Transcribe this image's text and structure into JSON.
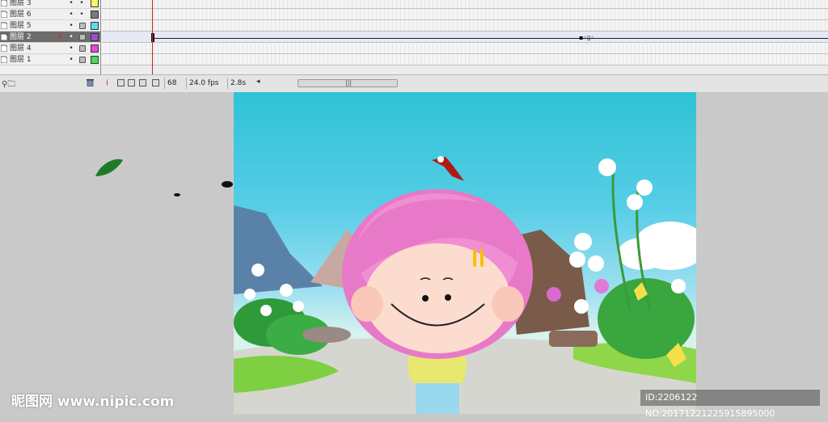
{
  "layers": [
    {
      "name": "图层 3",
      "swatch": "#f5f56a",
      "locked": false,
      "selected": false
    },
    {
      "name": "图层 6",
      "swatch": "#7a7a7a",
      "locked": false,
      "selected": false
    },
    {
      "name": "图层 5",
      "swatch": "#5ed8f0",
      "locked": true,
      "selected": false
    },
    {
      "name": "图层 2",
      "swatch": "#9a4dd8",
      "locked": true,
      "selected": true
    },
    {
      "name": "图层 4",
      "swatch": "#ee44d8",
      "locked": true,
      "selected": false
    },
    {
      "name": "图层 1",
      "swatch": "#44dd55",
      "locked": true,
      "selected": false
    }
  ],
  "timeline_status": {
    "current_frame": "68",
    "frame_rate": "24.0 fps",
    "elapsed_time": "2.8s"
  },
  "colors": {
    "playhead": "#cc2222",
    "hair": "#e879c8",
    "sky": "#2fc3d4"
  },
  "watermark": {
    "site": "昵图网 www.nipic.com",
    "id_text": "ID:2206122 NO:20171221225915895000"
  }
}
